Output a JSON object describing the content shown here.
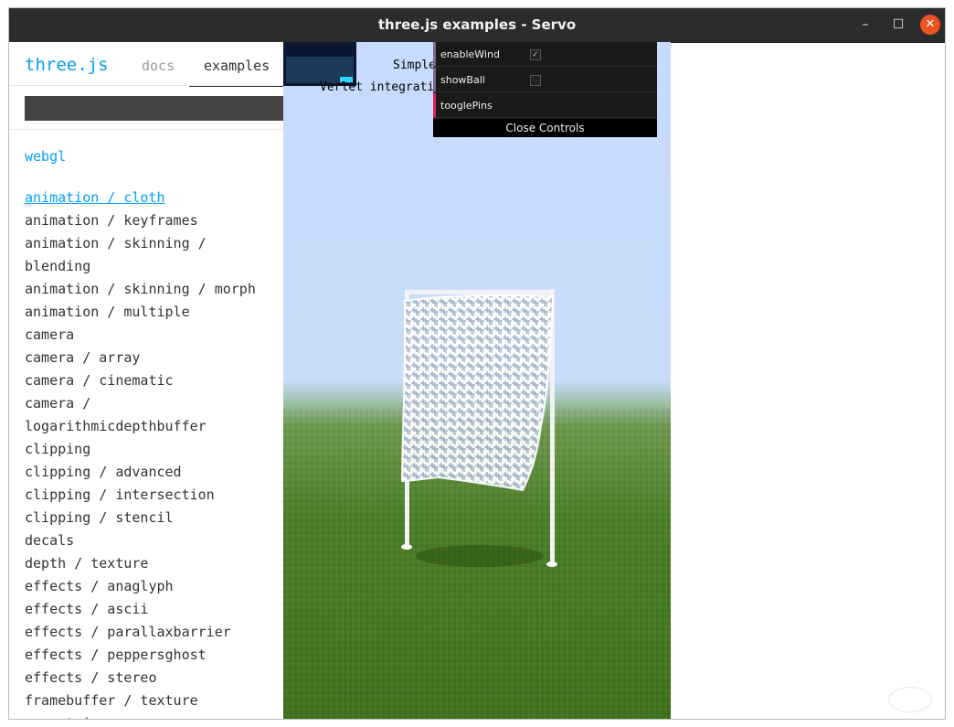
{
  "window": {
    "title": "three.js examples - Servo",
    "minimize_label": "–",
    "maximize_label": "☐",
    "close_label": "✕"
  },
  "sidebar": {
    "logo": "three.js",
    "tabs": [
      {
        "label": "docs"
      },
      {
        "label": "examples"
      }
    ],
    "search": {
      "value": "",
      "placeholder": ""
    },
    "category": "webgl",
    "items": [
      "animation / cloth",
      "animation / keyframes",
      "animation / skinning /",
      "blending",
      "animation / skinning / morph",
      "animation / multiple",
      "camera",
      "camera / array",
      "camera / cinematic",
      "camera /",
      "logarithmicdepthbuffer",
      "clipping",
      "clipping / advanced",
      "clipping / intersection",
      "clipping / stencil",
      "decals",
      "depth / texture",
      "effects / anaglyph",
      "effects / ascii",
      "effects / parallaxbarrier",
      "effects / peppersghost",
      "effects / stereo",
      "framebuffer / texture",
      "geometries"
    ],
    "selected_index": 0
  },
  "viewport": {
    "info_line1": "Simple",
    "info_line2": "Verlet integrati",
    "gui": {
      "controls": [
        {
          "label": "enableWind",
          "checked": true,
          "mark": "✓"
        },
        {
          "label": "showBall",
          "checked": false,
          "mark": ""
        },
        {
          "label": "tooglePins"
        }
      ],
      "close_label": "Close Controls"
    }
  },
  "colors": {
    "accent": "#049ef4",
    "titlebar": "#2c2c2c",
    "close_button": "#e95420"
  }
}
